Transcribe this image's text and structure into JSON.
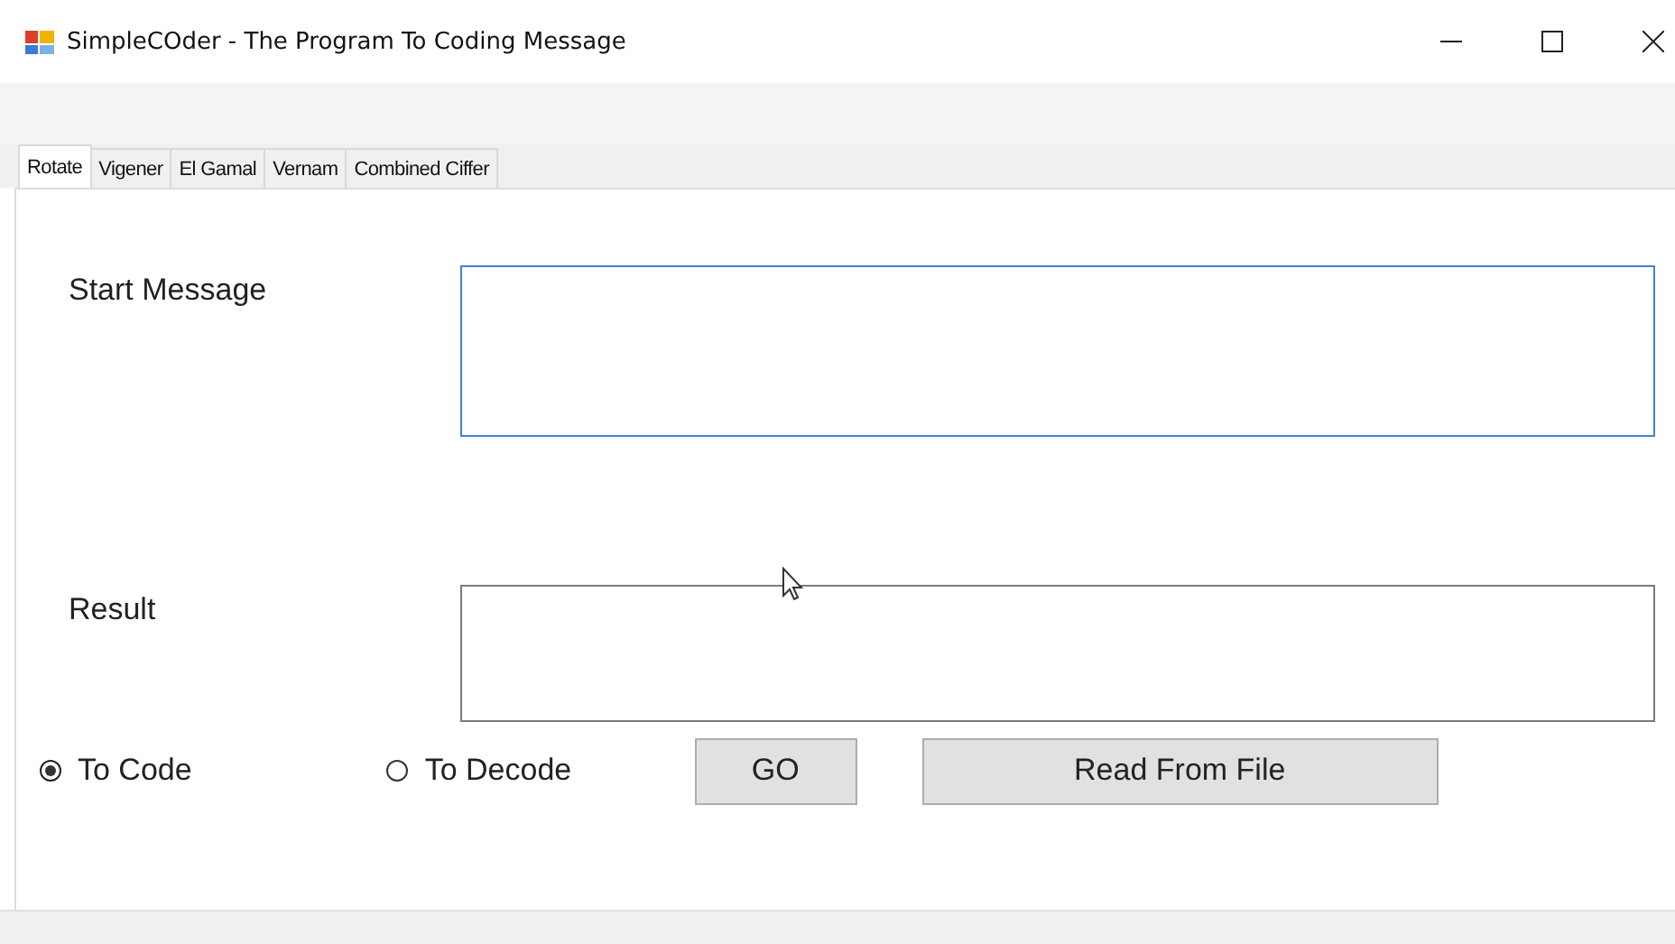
{
  "window": {
    "title": "SimpleCOder - The Program To Coding Message"
  },
  "tabs": [
    {
      "label": "Rotate",
      "selected": true
    },
    {
      "label": "Vigener",
      "selected": false
    },
    {
      "label": "El Gamal",
      "selected": false
    },
    {
      "label": "Vernam",
      "selected": false
    },
    {
      "label": "Combined Ciffer",
      "selected": false
    }
  ],
  "fields": [
    {
      "label": "Start Message",
      "focused": true
    },
    {
      "label": "Result",
      "focused": false
    }
  ],
  "radios": [
    {
      "label": "To Code",
      "selected": true
    },
    {
      "label": "To Decode",
      "selected": false
    }
  ],
  "buttons": [
    {
      "label": "GO"
    },
    {
      "label": "Read From File"
    }
  ]
}
